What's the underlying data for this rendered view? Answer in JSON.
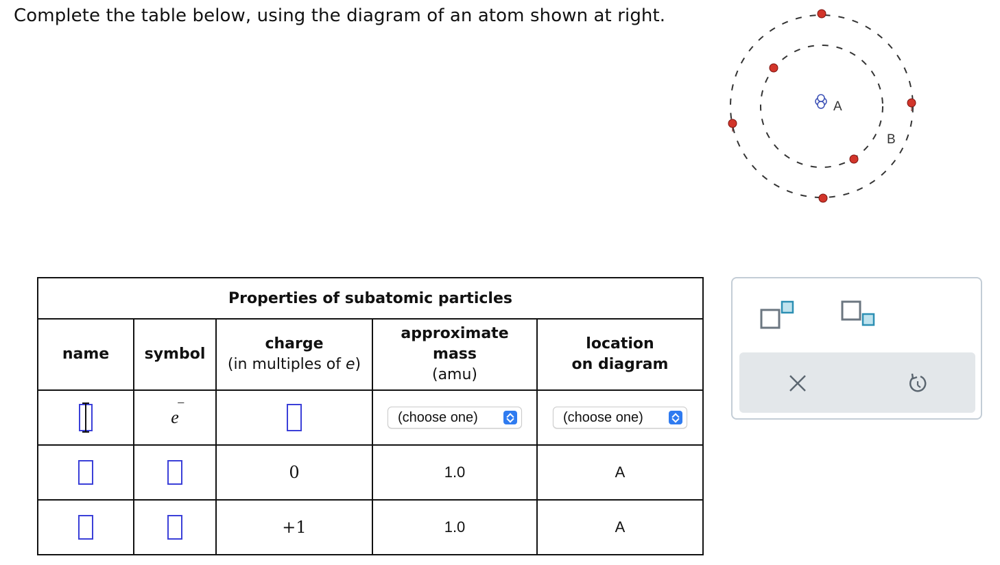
{
  "prompt": "Complete the table below, using the diagram of an atom shown at right.",
  "atom_diagram": {
    "label_nucleus": "A",
    "label_shell": "B",
    "colors": {
      "electron": "#d2352a",
      "orbit": "#333333",
      "nucleus": "#3a4fb5"
    }
  },
  "table": {
    "title": "Properties of subatomic particles",
    "headers": {
      "name": "name",
      "symbol": "symbol",
      "charge": "charge",
      "charge_sub": "(in multiples of ",
      "charge_sub_e": "e",
      "charge_sub_end": ")",
      "mass": "approximate",
      "mass_2": "mass",
      "mass_sub": "(amu)",
      "location": "location",
      "location_2": "on diagram"
    },
    "rows": [
      {
        "name": "",
        "symbol": "e",
        "symbol_sup": "–",
        "charge": "",
        "mass": "(choose one)",
        "location": "(choose one)"
      },
      {
        "name": "",
        "symbol": "",
        "charge": "0",
        "mass": "1.0",
        "location": "A"
      },
      {
        "name": "",
        "symbol": "",
        "charge": "+1",
        "mass": "1.0",
        "location": "A"
      }
    ]
  },
  "tools": {
    "superscript": "superscript-tool",
    "subscript": "subscript-tool",
    "clear": "×",
    "undo": "undo"
  }
}
